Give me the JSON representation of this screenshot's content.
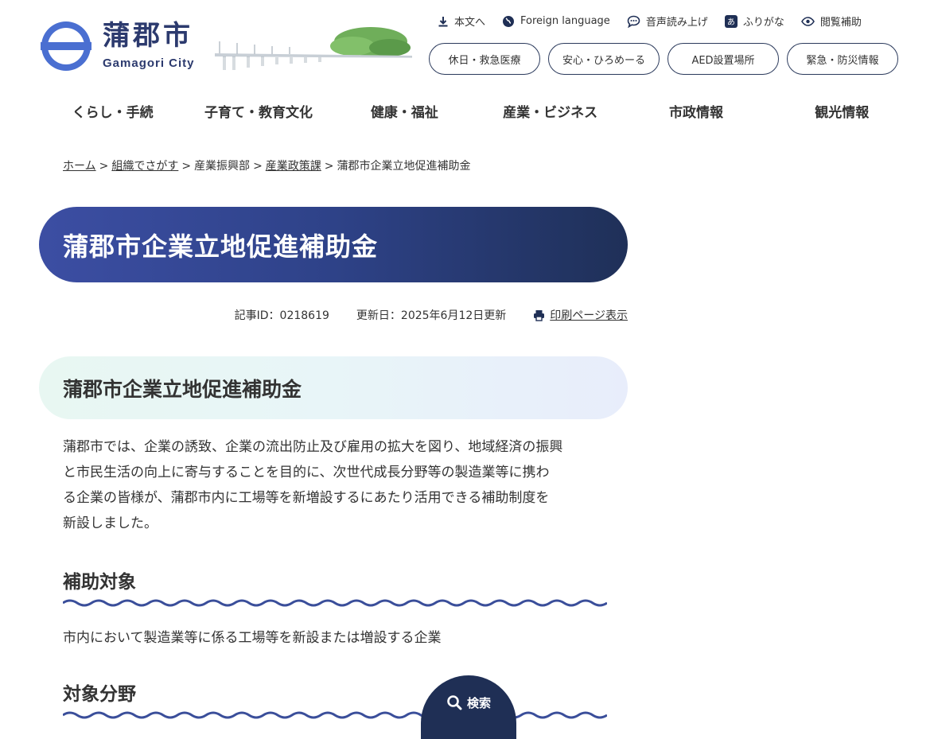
{
  "header": {
    "logo_name": "蒲郡市",
    "logo_en": "Gamagori City",
    "util": [
      {
        "label": "本文へ",
        "icon": "download-icon"
      },
      {
        "label": "Foreign language",
        "icon": "globe-icon"
      },
      {
        "label": "音声読み上げ",
        "icon": "speech-bubble-icon"
      },
      {
        "label": "ふりがな",
        "icon": "furigana-icon",
        "glyph": "あ"
      },
      {
        "label": "閲覧補助",
        "icon": "eye-icon"
      }
    ],
    "quick_buttons": [
      "休日・救急医療",
      "安心・ひろめーる",
      "AED設置場所",
      "緊急・防災情報"
    ],
    "global_nav": [
      "くらし・手続",
      "子育て・教育文化",
      "健康・福祉",
      "産業・ビジネス",
      "市政情報",
      "観光情報"
    ]
  },
  "breadcrumb": {
    "items": [
      {
        "label": "ホーム",
        "link": true
      },
      {
        "label": "組織でさがす",
        "link": true
      },
      {
        "label": "産業振興部",
        "link": false
      },
      {
        "label": "産業政策課",
        "link": true
      },
      {
        "label": "蒲郡市企業立地促進補助金",
        "link": false
      }
    ],
    "separator": ">"
  },
  "page": {
    "title": "蒲郡市企業立地促進補助金",
    "article_id": "記事ID：0218619",
    "updated": "更新日：2025年6月12日更新",
    "print_label": "印刷ページ表示"
  },
  "content": {
    "h2": "蒲郡市企業立地促進補助金",
    "intro_lines": [
      "蒲郡市では、企業の誘致、企業の流出防止及び雇用の拡大を図り、地域経済の振興",
      "と市民生活の向上に寄与することを目的に、次世代成長分野等の製造業等に携わ",
      "る企業の皆様が、蒲郡市内に工場等を新増設するにあたり活用できる補助制度を",
      "新設しました。"
    ],
    "section1": {
      "heading": "補助対象",
      "text": "市内において製造業等に係る工場等を新設または増設する企業"
    },
    "section2": {
      "heading": "対象分野"
    }
  },
  "search": {
    "label": "検索"
  },
  "colors": {
    "navy": "#1f2f55",
    "title_gradient_start": "#3c4ea3",
    "title_gradient_end": "#1f3058",
    "wave": "#3a4e9a",
    "logo_blue": "#4a6fd1"
  }
}
